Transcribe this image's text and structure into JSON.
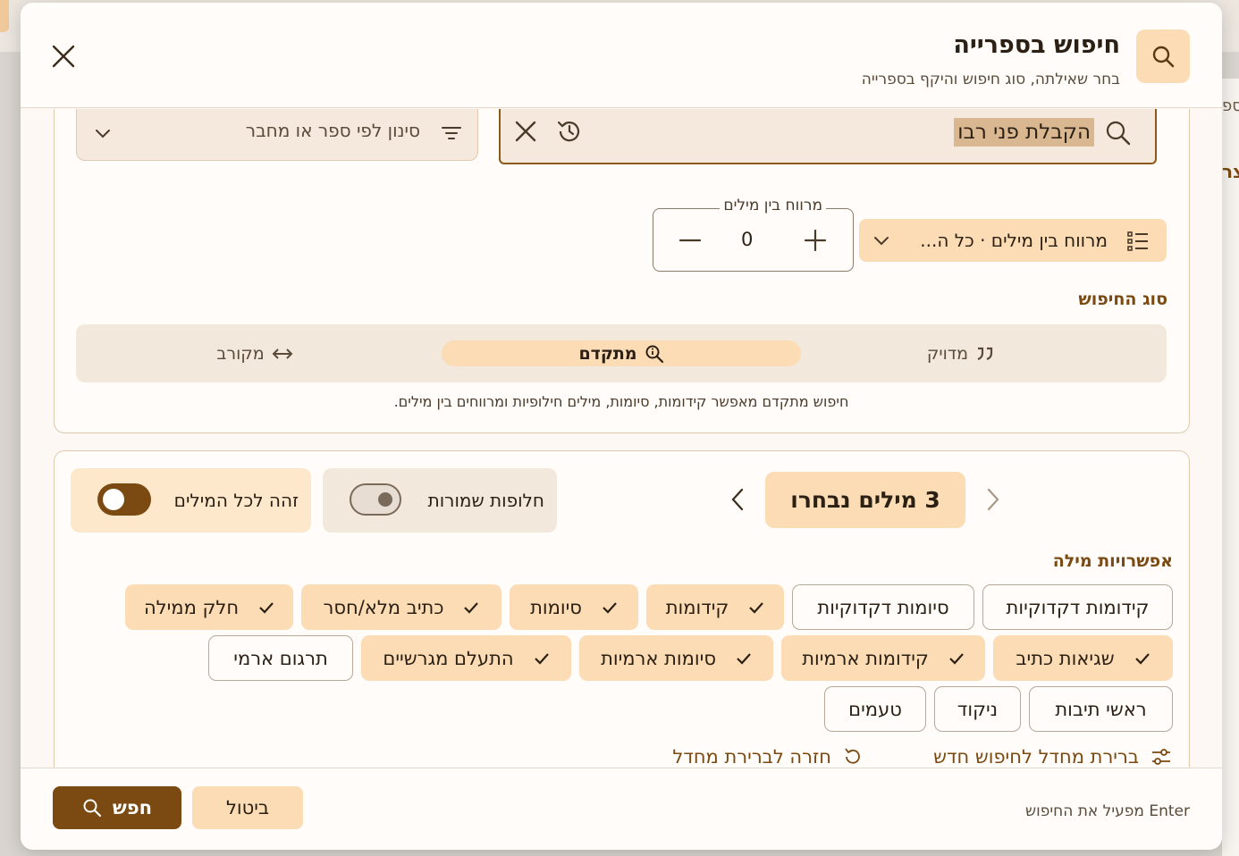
{
  "dialog": {
    "title": "חיפוש בספרייה",
    "subtitle": "בחר שאילתה, סוג חיפוש והיקף בספרייה",
    "header_icon": "search-icon",
    "close_icon": "close-icon"
  },
  "search": {
    "query": "הקבלת פני רבו",
    "icons": [
      "search-icon",
      "history-icon",
      "clear-icon"
    ]
  },
  "filter": {
    "label": "סינון לפי ספר או מחבר",
    "icons": [
      "filter-icon",
      "chevron-down-icon"
    ]
  },
  "proximity": {
    "legend": "מרווח בין מילים",
    "value": "0"
  },
  "mode_dropdown": {
    "label": "מרווח בין מילים · כל ה...",
    "icons": [
      "list-icon",
      "chevron-down-icon"
    ]
  },
  "search_type": {
    "title": "סוג החיפוש",
    "segments": [
      {
        "label": "מדויק",
        "icon": "quote-icon",
        "active": false
      },
      {
        "label": "מתקדם",
        "icon": "zoom-info-icon",
        "active": true
      },
      {
        "label": "מקורב",
        "icon": "swap-horizontal-icon",
        "active": false
      }
    ],
    "help": "חיפוש מתקדם מאפשר קידומות, סיומות, מילים חילופיות ומרווחים בין מילים."
  },
  "words": {
    "selected_label": "3 מילים נבחרו",
    "toggle_reserved": {
      "label": "חלופות שמורות",
      "on": false
    },
    "toggle_all_words": {
      "label": "זהה לכל המילים",
      "on": true
    },
    "options_title": "אפשרויות מילה",
    "chips": [
      {
        "label": "קידומות דקדוקיות",
        "on": false
      },
      {
        "label": "סיומות דקדוקיות",
        "on": false
      },
      {
        "label": "קידומות",
        "on": true
      },
      {
        "label": "סיומות",
        "on": true
      },
      {
        "label": "כתיב מלא/חסר",
        "on": true
      },
      {
        "label": "חלק ממילה",
        "on": true
      },
      {
        "label": "שגיאות כתיב",
        "on": true
      },
      {
        "label": "קידומות ארמיות",
        "on": true
      },
      {
        "label": "סיומות ארמיות",
        "on": true
      },
      {
        "label": "התעלם מגרשיים",
        "on": true
      },
      {
        "label": "תרגום ארמי",
        "on": false
      },
      {
        "label": "ראשי תיבות",
        "on": false
      },
      {
        "label": "ניקוד",
        "on": false
      },
      {
        "label": "טעמים",
        "on": false
      }
    ],
    "link_new_default": "ברירת מחדל לחיפוש חדש",
    "link_reset_default": "חזרה לברירת מחדל"
  },
  "footer": {
    "hint": "Enter מפעיל את החיפוש",
    "cancel_label": "ביטול",
    "search_label": "חפש"
  },
  "background": {
    "right_text_1": "ספ",
    "right_text_2": "צר"
  },
  "colors": {
    "accent": "#7a4a12",
    "accent_light": "#fbdcb5",
    "surface": "#fffcf9",
    "segment_bg": "#f3e8dc"
  }
}
